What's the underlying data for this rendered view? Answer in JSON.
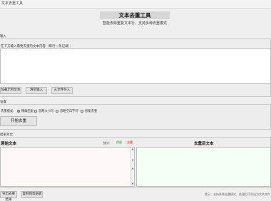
{
  "window": {
    "title": "文本去重工具"
  },
  "header": {
    "title": "文本去重工具",
    "subtitle": "智能去除重复文本行，支持多种去重模式"
  },
  "input_section": {
    "group_label": "输入",
    "hint": "在下方输入需要去重的文本内容（每行一条记录）：",
    "text": "",
    "buttons": {
      "example": "加载示例文本",
      "clear": "清空输入",
      "import": "从文件导入"
    }
  },
  "settings_section": {
    "group_label": "设置",
    "mode_label": "去重模式:",
    "modes": [
      "精确匹配",
      "忽略大小写",
      "忽略空白字符",
      "智能去重"
    ],
    "selected_mode": "精确匹配",
    "start_button": "开始去重"
  },
  "results_section": {
    "group_label": "结果对比",
    "original_title": "原始文本",
    "deduped_title": "去重后文本",
    "stats_label": "统计:",
    "keep_badge": "保留",
    "remove_badge": "去重",
    "original_text": "",
    "deduped_text": ""
  },
  "footer": {
    "export_button": "导出去重结果",
    "copy_button": "复制到剪贴板",
    "tip": "提示：支持多种去重模式，处理后可导出为文本文件"
  },
  "colors": {
    "keep_bg": "#e6f4e6",
    "keep_fg": "#2e8b2e",
    "remove_bg": "#fde3e3",
    "remove_fg": "#cc2222",
    "original_bg": "#fff8f8",
    "deduped_bg": "#f6fff6"
  }
}
